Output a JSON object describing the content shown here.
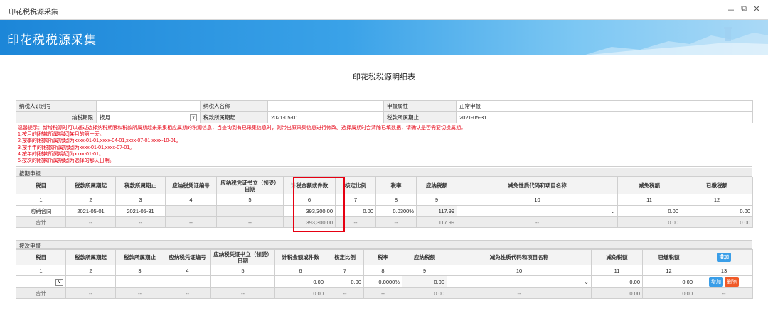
{
  "window": {
    "title": "印花税税源采集",
    "controls": [
      "－",
      "⧉",
      "✕"
    ]
  },
  "banner": {
    "title": "印花税税源采集"
  },
  "page": {
    "title": "印花税税源明细表"
  },
  "info": {
    "taxpayer_id_label": "纳税人识别号",
    "taxpayer_id_value": "",
    "taxpayer_name_label": "纳税人名称",
    "taxpayer_name_value": "",
    "declare_attr_label": "申报属性",
    "declare_attr_value": "正常申报",
    "period_label": "纳税期限",
    "period_value": "按月",
    "start_label": "税款所属期起",
    "start_value": "2021-05-01",
    "end_label": "税款所属期止",
    "end_value": "2021-05-31"
  },
  "notice": [
    "温馨提示：新增税源时可以通过选择纳税期限和税款所属期起来采集相应属期的税源信息，当查询到有已采集信息时，则带出原采集信息进行修改。选择属期时会清除已填数据，请确认是否需要切换属期。",
    "1.按月的[税款所属期起]某月的第一天。",
    "2.按季的[税款所属期起]为xxxx-01-01,xxxx-04-01,xxxx-07-01,xxxx-10-01。",
    "3.按半年的[税款所属期起]为xxxx-01-01,xxxx-07-01。",
    "4.按年的[税款所属期起]为xxxx-01-01。",
    "5.按次的[税款所属期起]为选择的那天日期。"
  ],
  "periodic": {
    "section_label": "按期申报",
    "headers": [
      "税目",
      "税款所属期起",
      "税款所属期止",
      "应纳税凭证编号",
      "应纳税凭证书立（领受）日期",
      "计税金额或件数",
      "核定比例",
      "税率",
      "应纳税额",
      "减免性质代码和项目名称",
      "减免税额",
      "已缴税额"
    ],
    "index_row": [
      "1",
      "2",
      "3",
      "4",
      "5",
      "6",
      "7",
      "8",
      "9",
      "10",
      "11",
      "12"
    ],
    "row": {
      "item": "购销合同",
      "start": "2021-05-01",
      "end": "2021-05-31",
      "voucher_no": "",
      "voucher_date": "",
      "amount": "393,300.00",
      "ratio": "0.00",
      "rate": "0.0300%",
      "tax": "117.99",
      "relief_code": "",
      "relief_tax": "0.00",
      "paid_tax": "0.00"
    },
    "total": {
      "label": "合计",
      "dash": "--",
      "amount": "393,300.00",
      "tax": "117.99",
      "relief_tax": "0.00",
      "paid_tax": "0.00"
    }
  },
  "per_time": {
    "section_label": "按次申报",
    "headers": [
      "税目",
      "税款所属期起",
      "税款所属期止",
      "应纳税凭证编号",
      "应纳税凭证书立（领受）日期",
      "计税金额或件数",
      "核定比例",
      "税率",
      "应纳税额",
      "减免性质代码和项目名称",
      "减免税额",
      "已缴税额"
    ],
    "add_header_btn": "增加",
    "index_row": [
      "1",
      "2",
      "3",
      "4",
      "5",
      "6",
      "7",
      "8",
      "9",
      "10",
      "11",
      "12",
      "13"
    ],
    "row": {
      "amount": "0.00",
      "ratio": "0.00",
      "rate": "0.0000%",
      "tax": "0.00",
      "relief_tax": "0.00",
      "paid_tax": "0.00",
      "add_btn": "增加",
      "del_btn": "删除"
    },
    "total": {
      "label": "合计",
      "dash": "--",
      "amount": "0.00",
      "tax": "0.00",
      "relief_tax": "0.00",
      "paid_tax": "0.00"
    }
  },
  "colors": {
    "banner": "#1c86d8",
    "notice": "#e60012",
    "highlight": "#e60012",
    "add_button": "#3a9ee8",
    "delete_button": "#f05a28"
  }
}
